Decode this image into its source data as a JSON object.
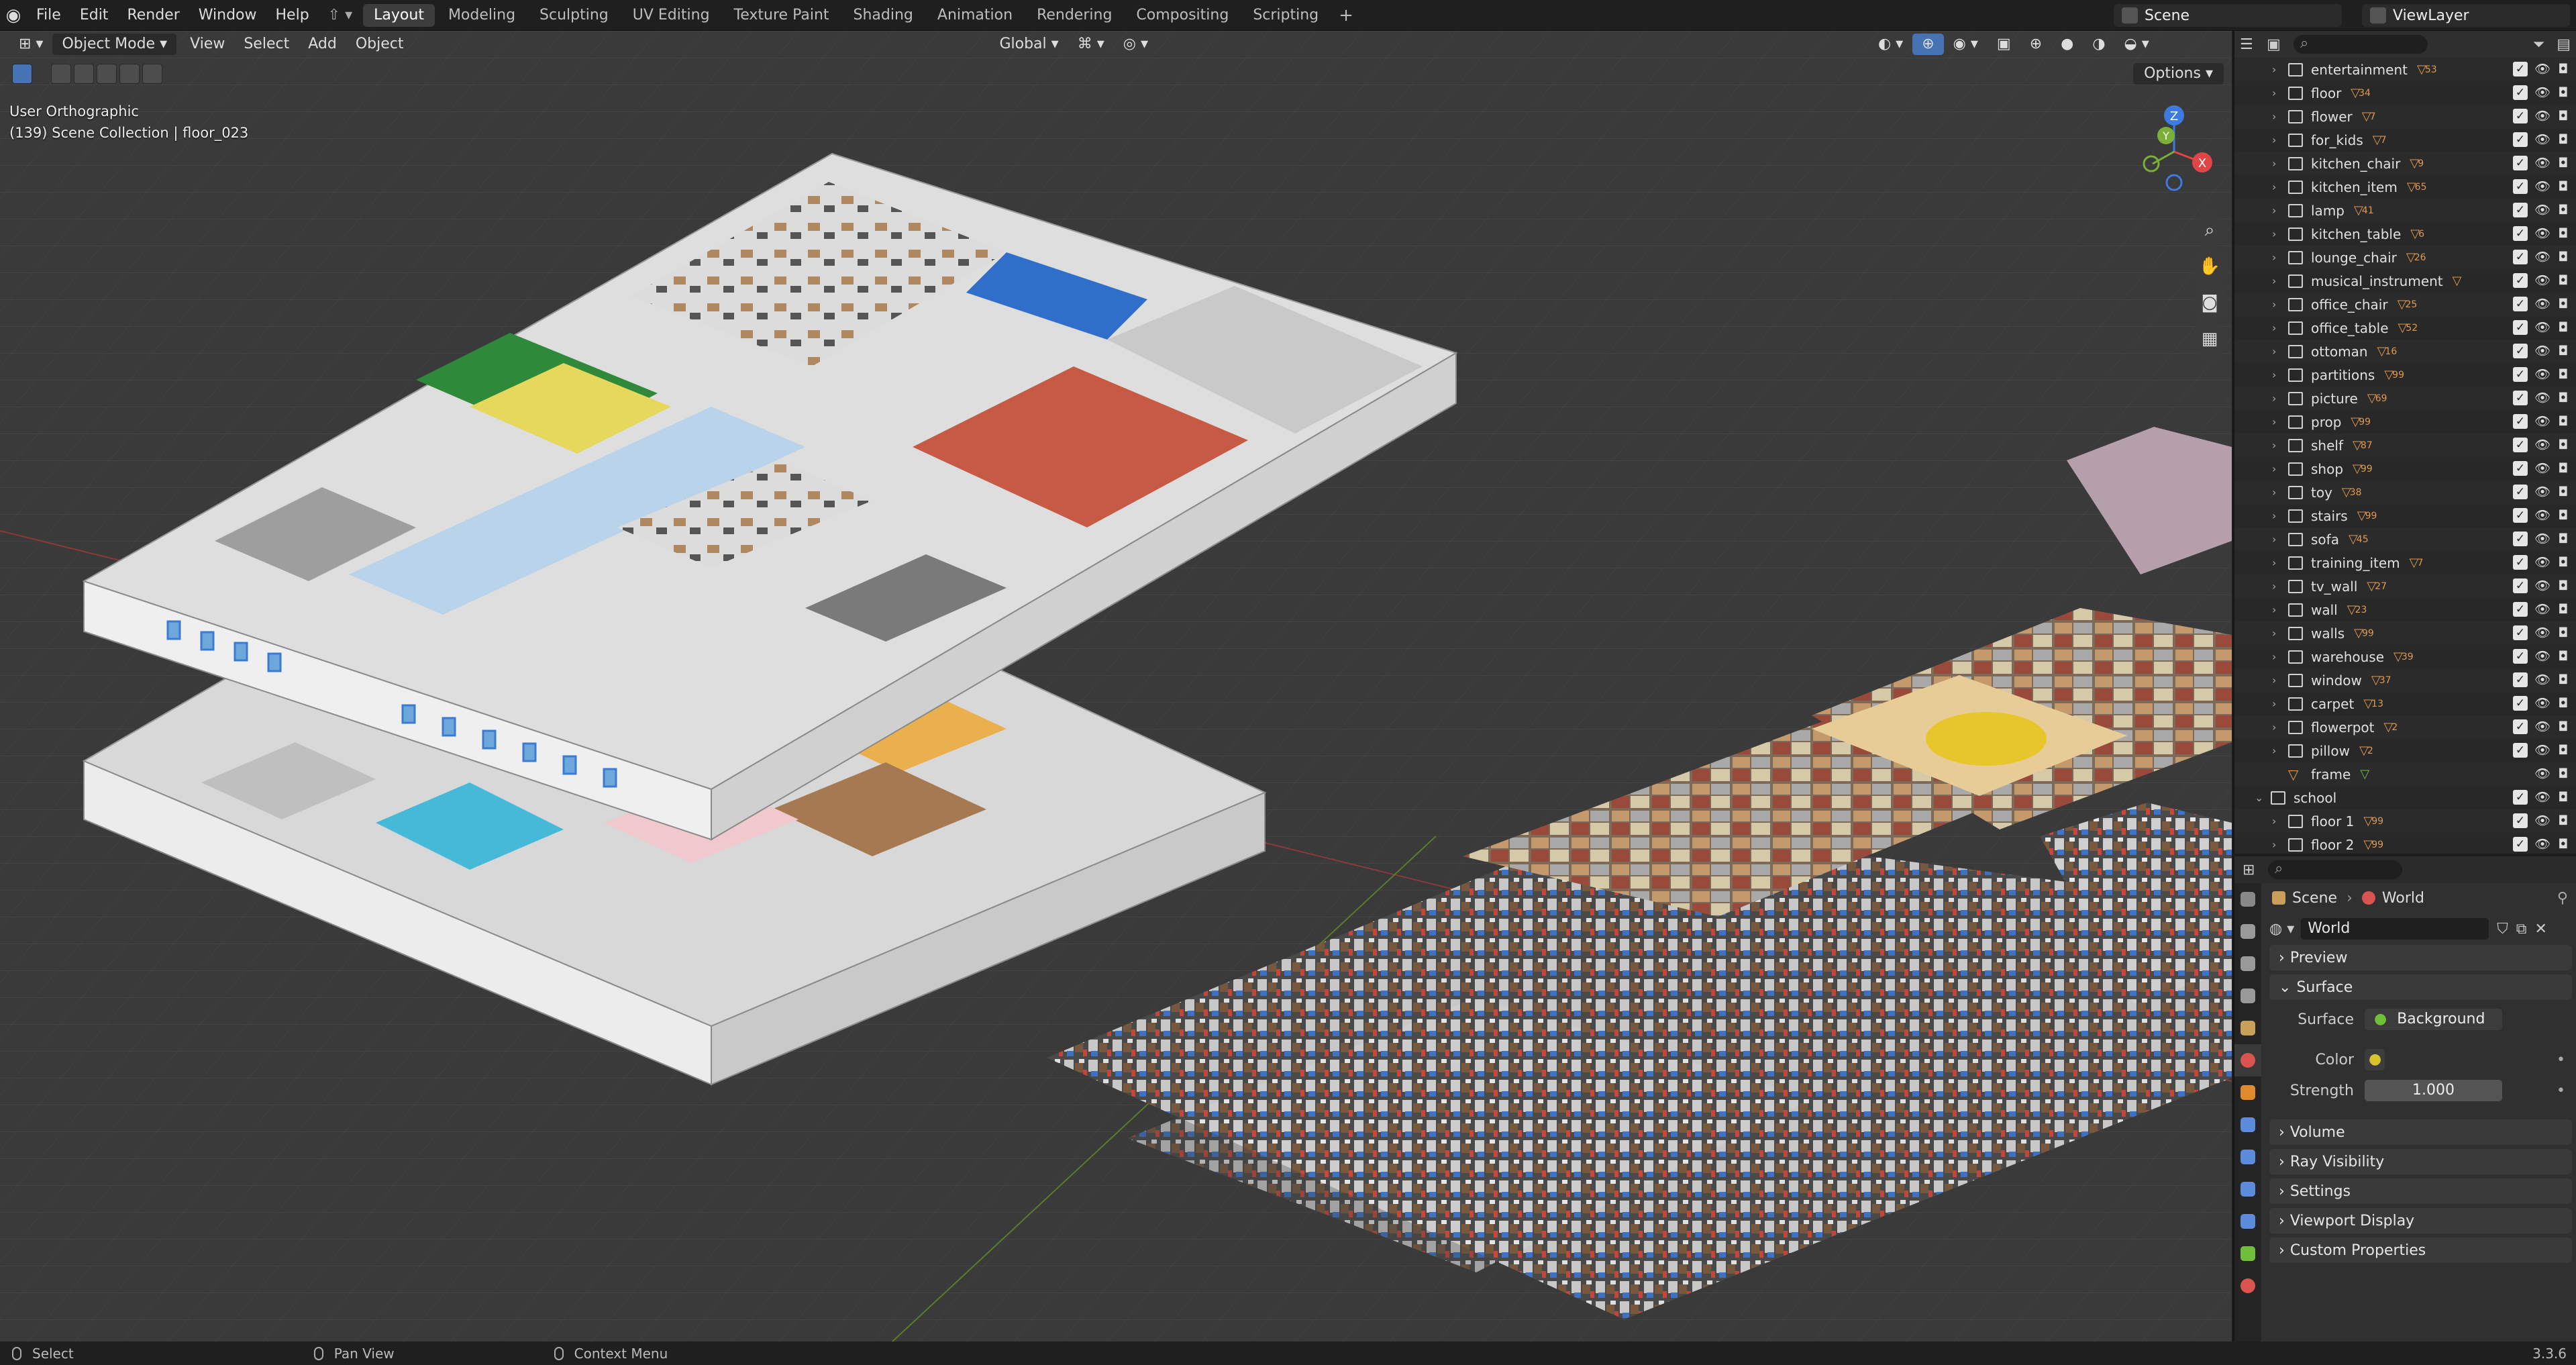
{
  "topbar": {
    "menus": [
      "File",
      "Edit",
      "Render",
      "Window",
      "Help"
    ],
    "workspaces": [
      "Layout",
      "Modeling",
      "Sculpting",
      "UV Editing",
      "Texture Paint",
      "Shading",
      "Animation",
      "Rendering",
      "Compositing",
      "Scripting"
    ],
    "active_workspace": "Layout",
    "scene": "Scene",
    "view_layer": "ViewLayer"
  },
  "viewport": {
    "mode": "Object Mode",
    "menus": [
      "View",
      "Select",
      "Add",
      "Object"
    ],
    "transform": "Global",
    "options": "Options",
    "view_name": "User Orthographic",
    "collection_info": "(139) Scene Collection | floor_023",
    "gizmo_axes": [
      "Z",
      "Y",
      "X"
    ]
  },
  "outliner": {
    "items": [
      {
        "name": "entertainment",
        "count": "53"
      },
      {
        "name": "floor",
        "count": "34"
      },
      {
        "name": "flower",
        "count": "7"
      },
      {
        "name": "for_kids",
        "count": "7"
      },
      {
        "name": "kitchen_chair",
        "count": "9"
      },
      {
        "name": "kitchen_item",
        "count": "65"
      },
      {
        "name": "lamp",
        "count": "41"
      },
      {
        "name": "kitchen_table",
        "count": "6"
      },
      {
        "name": "lounge_chair",
        "count": "26"
      },
      {
        "name": "musical_instrument",
        "count": ""
      },
      {
        "name": "office_chair",
        "count": "25"
      },
      {
        "name": "office_table",
        "count": "52"
      },
      {
        "name": "ottoman",
        "count": "16"
      },
      {
        "name": "partitions",
        "count": "99"
      },
      {
        "name": "picture",
        "count": "69"
      },
      {
        "name": "prop",
        "count": "99"
      },
      {
        "name": "shelf",
        "count": "87"
      },
      {
        "name": "shop",
        "count": "99"
      },
      {
        "name": "toy",
        "count": "38"
      },
      {
        "name": "stairs",
        "count": "99"
      },
      {
        "name": "sofa",
        "count": "45"
      },
      {
        "name": "training_item",
        "count": "7"
      },
      {
        "name": "tv_wall",
        "count": "27"
      },
      {
        "name": "wall",
        "count": "23"
      },
      {
        "name": "walls",
        "count": "99"
      },
      {
        "name": "warehouse",
        "count": "39"
      },
      {
        "name": "window",
        "count": "37"
      },
      {
        "name": "carpet",
        "count": "13"
      },
      {
        "name": "flowerpot",
        "count": "2"
      },
      {
        "name": "pillow",
        "count": "2"
      },
      {
        "name": "frame",
        "count": ""
      },
      {
        "name": "school",
        "count": ""
      },
      {
        "name": "floor 1",
        "count": "99"
      },
      {
        "name": "floor 2",
        "count": "99"
      }
    ]
  },
  "properties": {
    "breadcrumb": [
      "Scene",
      "World"
    ],
    "world_name": "World",
    "panels": {
      "preview": "Preview",
      "surface": "Surface",
      "volume": "Volume",
      "ray_visibility": "Ray Visibility",
      "settings": "Settings",
      "viewport_display": "Viewport Display",
      "custom_properties": "Custom Properties"
    },
    "surface_label": "Surface",
    "surface_value": "Background",
    "color_label": "Color",
    "strength_label": "Strength",
    "strength_value": "1.000"
  },
  "statusbar": {
    "select": "Select",
    "pan": "Pan View",
    "context": "Context Menu",
    "version": "3.3.6"
  },
  "colors": {
    "accent": "#4772b3",
    "viewport_bg": "#3a3a3a",
    "object_orange": "#e09a4f"
  }
}
